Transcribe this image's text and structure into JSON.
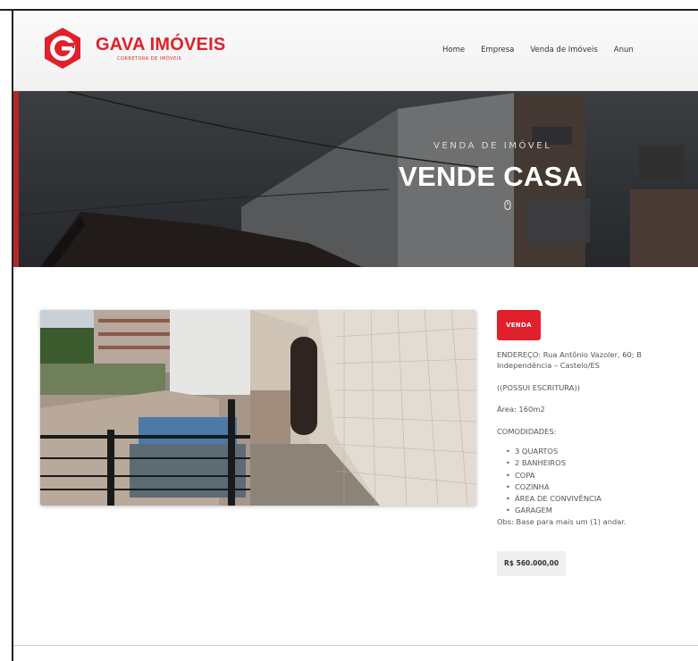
{
  "brand": {
    "name": "GAVA IMÓVEIS",
    "tagline": "CORRETORA DE IMÓVEIS",
    "accent_color": "#e0202b"
  },
  "nav": {
    "items": [
      {
        "label": "Home"
      },
      {
        "label": "Empresa"
      },
      {
        "label": "Venda de Imóveis"
      },
      {
        "label": "Anun"
      }
    ]
  },
  "hero": {
    "kicker": "VENDA DE IMÓVEL",
    "title": "VENDE CASA",
    "scroll_icon": "mouse-scroll-icon"
  },
  "listing": {
    "badge": "VENDA",
    "address_line1": "ENDEREÇO: Rua Antônio Vazoler, 60; B",
    "address_line2": "Independência – Castelo/ES",
    "deed": "((POSSUI ESCRITURA))",
    "area": "Área: 160m2",
    "amenities_title": "COMODIDADES:",
    "amenities": [
      "3 QUARTOS",
      "2 BANHEIROS",
      "COPA",
      "COZINHA",
      "ÁREA DE CONVIVÊNCIA",
      "GARAGEM"
    ],
    "obs": "Obs: Base para mais um (1) andar.",
    "price": "R$ 560.000,00"
  }
}
